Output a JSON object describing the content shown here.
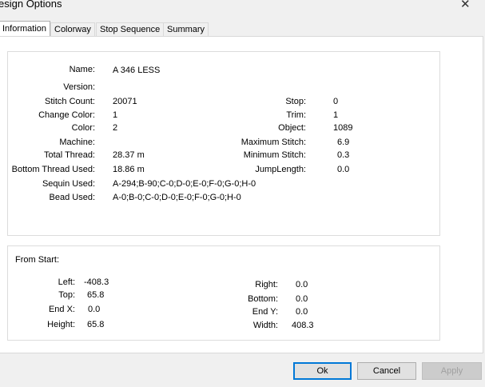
{
  "window": {
    "title": "esign Options",
    "close_glyph": "✕"
  },
  "tabs": [
    {
      "label": "Information"
    },
    {
      "label": "Colorway"
    },
    {
      "label": "Stop Sequence"
    },
    {
      "label": "Summary"
    }
  ],
  "info": {
    "name_label": "Name:",
    "name_value": "A 346 LESS",
    "version_label": "Version:",
    "version_value": "",
    "stitch_count_label": "Stitch Count:",
    "stitch_count_value": "20071",
    "change_color_label": "Change Color:",
    "change_color_value": "1",
    "color_label": "Color:",
    "color_value": "2",
    "machine_label": "Machine:",
    "machine_value": "",
    "total_thread_label": "Total Thread:",
    "total_thread_value": "28.37 m",
    "bottom_thread_label": "Bottom Thread Used:",
    "bottom_thread_value": "18.86 m",
    "sequin_label": "Sequin Used:",
    "sequin_value": "A-294;B-90;C-0;D-0;E-0;F-0;G-0;H-0",
    "bead_label": "Bead Used:",
    "bead_value": "A-0;B-0;C-0;D-0;E-0;F-0;G-0;H-0",
    "stop_label": "Stop:",
    "stop_value": "0",
    "trim_label": "Trim:",
    "trim_value": "1",
    "object_label": "Object:",
    "object_value": "1089",
    "max_stitch_label": "Maximum Stitch:",
    "max_stitch_value": "6.9",
    "min_stitch_label": "Minimum Stitch:",
    "min_stitch_value": "0.3",
    "jump_length_label": "JumpLength:",
    "jump_length_value": "0.0"
  },
  "from_start": {
    "title": "From Start:",
    "left_label": "Left:",
    "left_value": "-408.3",
    "top_label": "Top:",
    "top_value": "65.8",
    "endx_label": "End X:",
    "endx_value": "0.0",
    "height_label": "Height:",
    "height_value": "65.8",
    "right_label": "Right:",
    "right_value": "0.0",
    "bottom_label": "Bottom:",
    "bottom_value": "0.0",
    "endy_label": "End Y:",
    "endy_value": "0.0",
    "width_label": "Width:",
    "width_value": "408.3"
  },
  "buttons": {
    "ok": "Ok",
    "cancel": "Cancel",
    "apply": "Apply"
  }
}
